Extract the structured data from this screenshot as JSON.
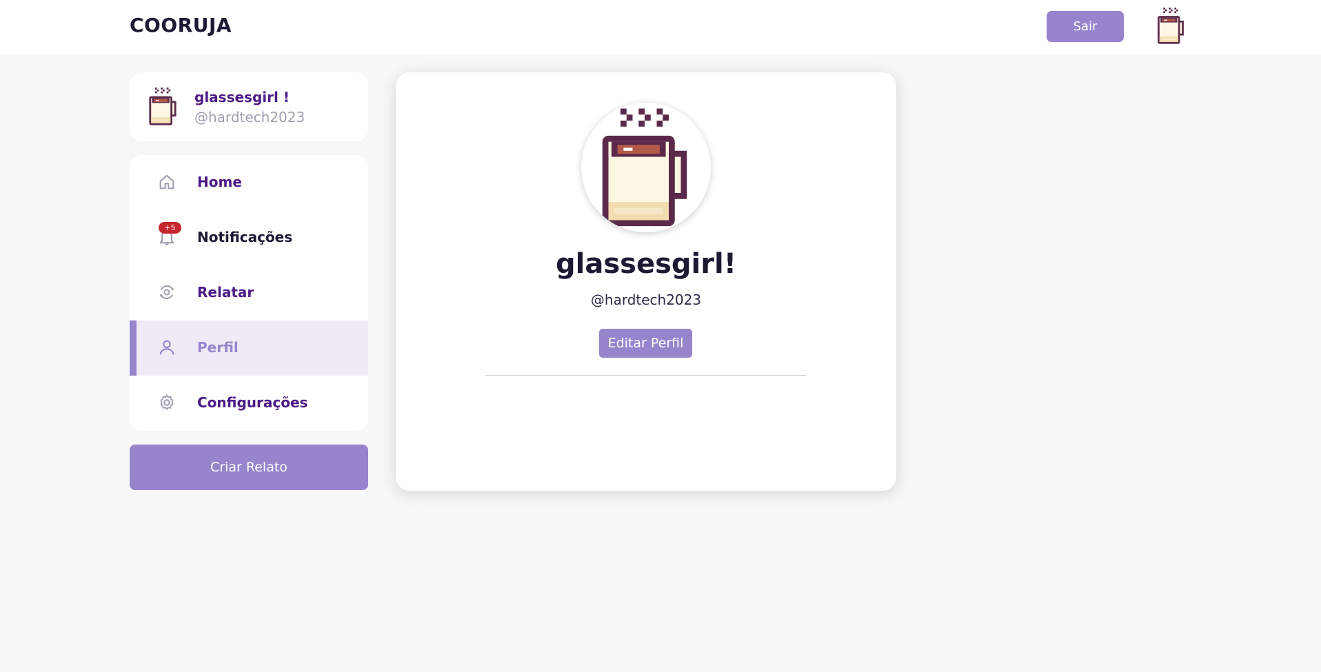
{
  "header": {
    "logo": "COORUJA",
    "logout_label": "Sair",
    "avatar_icon": "coffee-mug-icon"
  },
  "user_card": {
    "name": "glassesgirl !",
    "handle": "@hardtech2023",
    "avatar_icon": "coffee-mug-icon"
  },
  "nav": {
    "items": [
      {
        "label": "Home",
        "icon": "home-icon",
        "active": false
      },
      {
        "label": "Notificações",
        "icon": "bell-icon",
        "badge": "+5",
        "active": false
      },
      {
        "label": "Relatar",
        "icon": "report-icon",
        "active": false
      },
      {
        "label": "Perfil",
        "icon": "user-icon",
        "active": true
      },
      {
        "label": "Configurações",
        "icon": "gear-icon",
        "active": false
      }
    ]
  },
  "create_button_label": "Criar Relato",
  "profile": {
    "name": "glassesgirl!",
    "handle": "@hardtech2023",
    "edit_label": "Editar Perfil",
    "avatar_icon": "coffee-mug-icon"
  },
  "colors": {
    "accent": "#9884cd",
    "accent_dark": "#4b1a86",
    "text_dark": "#1c1a33",
    "badge": "#c7252f",
    "background": "#f7f7f7"
  }
}
